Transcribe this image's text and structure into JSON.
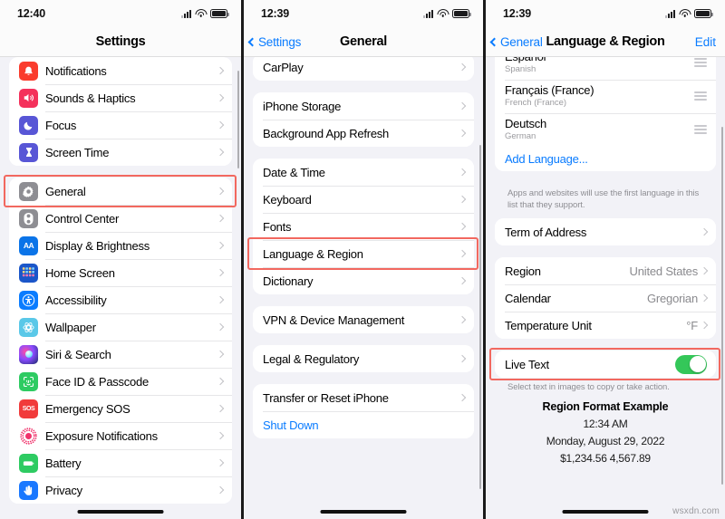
{
  "panel1": {
    "status": {
      "time": "12:40"
    },
    "nav": {
      "title": "Settings"
    },
    "groups": [
      {
        "rows": [
          {
            "label": "Notifications",
            "icon": "notifications-icon"
          },
          {
            "label": "Sounds & Haptics",
            "icon": "sounds-haptics-icon"
          },
          {
            "label": "Focus",
            "icon": "focus-icon"
          },
          {
            "label": "Screen Time",
            "icon": "screen-time-icon"
          }
        ]
      },
      {
        "rows": [
          {
            "label": "General",
            "icon": "general-gear-icon",
            "highlight": true
          },
          {
            "label": "Control Center",
            "icon": "control-center-icon"
          },
          {
            "label": "Display & Brightness",
            "icon": "display-brightness-icon"
          },
          {
            "label": "Home Screen",
            "icon": "home-screen-icon"
          },
          {
            "label": "Accessibility",
            "icon": "accessibility-icon"
          },
          {
            "label": "Wallpaper",
            "icon": "wallpaper-icon"
          },
          {
            "label": "Siri & Search",
            "icon": "siri-search-icon"
          },
          {
            "label": "Face ID & Passcode",
            "icon": "face-id-icon"
          },
          {
            "label": "Emergency SOS",
            "icon": "emergency-sos-icon"
          },
          {
            "label": "Exposure Notifications",
            "icon": "exposure-notifications-icon"
          },
          {
            "label": "Battery",
            "icon": "battery-icon"
          },
          {
            "label": "Privacy",
            "icon": "privacy-icon"
          }
        ]
      }
    ]
  },
  "panel2": {
    "status": {
      "time": "12:39"
    },
    "nav": {
      "back": "Settings",
      "title": "General"
    },
    "groups": [
      {
        "rows": [
          {
            "label": "CarPlay"
          }
        ]
      },
      {
        "rows": [
          {
            "label": "iPhone Storage"
          },
          {
            "label": "Background App Refresh"
          }
        ]
      },
      {
        "rows": [
          {
            "label": "Date & Time"
          },
          {
            "label": "Keyboard"
          },
          {
            "label": "Fonts"
          },
          {
            "label": "Language & Region",
            "highlight": true
          },
          {
            "label": "Dictionary"
          }
        ]
      },
      {
        "rows": [
          {
            "label": "VPN & Device Management"
          }
        ]
      },
      {
        "rows": [
          {
            "label": "Legal & Regulatory"
          }
        ]
      },
      {
        "rows": [
          {
            "label": "Transfer or Reset iPhone"
          },
          {
            "label": "Shut Down",
            "blue": true,
            "nochev": true
          }
        ]
      }
    ]
  },
  "panel3": {
    "status": {
      "time": "12:39"
    },
    "nav": {
      "back": "General",
      "title": "Language & Region",
      "edit": "Edit"
    },
    "languages": [
      {
        "native": "Español",
        "sub": "Spanish"
      },
      {
        "native": "Français (France)",
        "sub": "French (France)"
      },
      {
        "native": "Deutsch",
        "sub": "German"
      }
    ],
    "add_language": "Add Language...",
    "footnote_languages": "Apps and websites will use the first language in this list that they support.",
    "term_of_address": "Term of Address",
    "region_rows": [
      {
        "label": "Region",
        "value": "United States"
      },
      {
        "label": "Calendar",
        "value": "Gregorian"
      },
      {
        "label": "Temperature Unit",
        "value": "°F"
      }
    ],
    "live_text": {
      "label": "Live Text",
      "state": "on"
    },
    "footnote_live_text": "Select text in images to copy or take action.",
    "example": {
      "title": "Region Format Example",
      "line1": "12:34 AM",
      "line2": "Monday, August 29, 2022",
      "line3": "$1,234.56   4,567.89"
    }
  },
  "watermark": "wsxdn.com",
  "colors": {
    "accent_blue": "#0a7cff",
    "highlight_red": "#f2685f",
    "toggle_green": "#34c759",
    "background": "#f2f2f7"
  }
}
